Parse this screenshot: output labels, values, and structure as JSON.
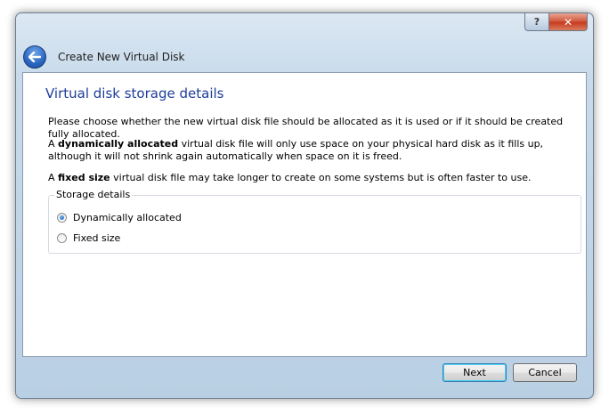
{
  "window": {
    "title": "Create New Virtual Disk",
    "controls": {
      "help": "?",
      "close": "✕"
    }
  },
  "page": {
    "heading": "Virtual disk storage details",
    "intro": "Please choose whether the new virtual disk file should be allocated as it is used or if it should be created fully allocated.",
    "dynamic_prefix": "A ",
    "dynamic_bold": "dynamically allocated",
    "dynamic_rest": " virtual disk file will only use space on your physical hard disk as it fills up, although it will not shrink again automatically when space on it is freed.",
    "fixed_prefix": "A ",
    "fixed_bold": "fixed size",
    "fixed_rest": " virtual disk file may take longer to create on some systems but is often faster to use."
  },
  "storage_details": {
    "legend": "Storage details",
    "options": [
      {
        "label": "Dynamically allocated",
        "selected": true
      },
      {
        "label": "Fixed size",
        "selected": false
      }
    ]
  },
  "buttons": {
    "next": "Next",
    "cancel": "Cancel"
  }
}
